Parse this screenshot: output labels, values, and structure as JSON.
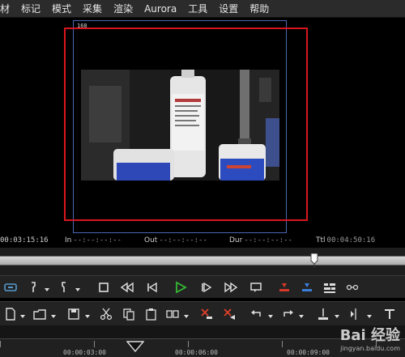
{
  "menu": {
    "items": [
      "材",
      "标记",
      "模式",
      "采集",
      "渲染",
      "Aurora",
      "工具",
      "设置",
      "帮助"
    ]
  },
  "preview": {
    "safe_label": "168"
  },
  "timecodes": {
    "current": "00:03:15:16",
    "in_label": "In",
    "in_value": "--:--:--:--",
    "out_label": "Out",
    "out_value": "--:--:--:--",
    "dur_label": "Dur",
    "dur_value": "--:--:--:--",
    "ttl_label": "Ttl",
    "ttl_value": "00:04:50:16"
  },
  "seek": {
    "position_fraction": 0.775
  },
  "ruler": {
    "ticks": [
      "00:00:03:00",
      "00:00:06:00",
      "00:00:09:00"
    ]
  },
  "watermark": {
    "main": "Bai 经验",
    "sub": "jingyan.baidu.com"
  },
  "colors": {
    "title_safe": "#4b67b3",
    "action_safe": "#d9151e",
    "play_green": "#35b835"
  }
}
